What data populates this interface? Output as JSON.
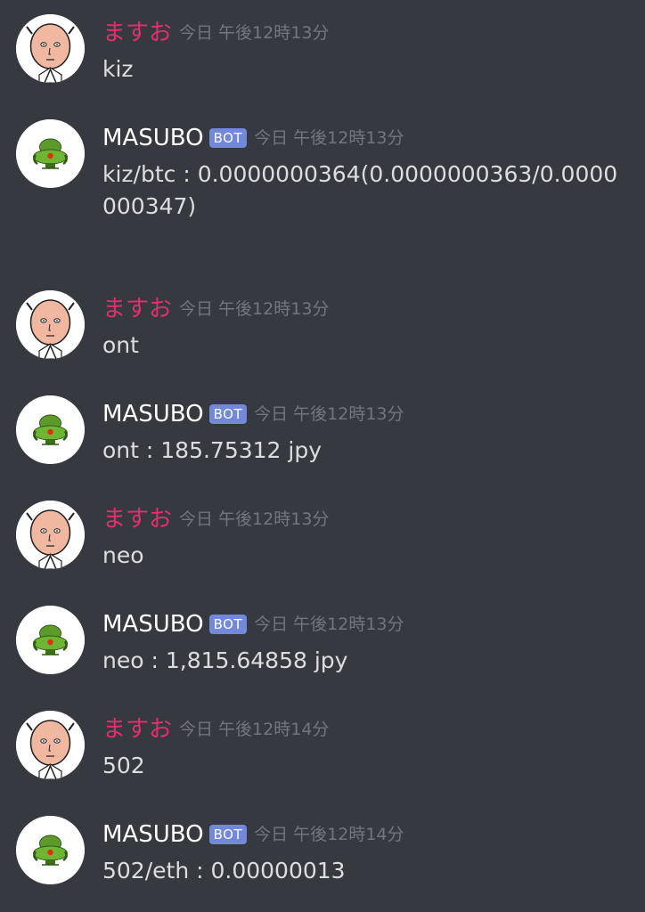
{
  "users": {
    "human": {
      "name": "ますお",
      "color": "#e0306e",
      "avatar": "bald-hero-avatar"
    },
    "bot": {
      "name": "MASUBO",
      "badge": "BOT",
      "color": "#ffffff",
      "avatar": "green-helmet-avatar"
    }
  },
  "messages": [
    {
      "author": "ますお",
      "time": "今日 午後12時13分",
      "text": "kiz"
    },
    {
      "author": "MASUBO",
      "badge": "BOT",
      "time": "今日 午後12時13分",
      "text": "kiz/btc : 0.0000000364(0.0000000363/0.0000000347)"
    },
    {
      "author": "ますお",
      "time": "今日 午後12時13分",
      "text": "ont"
    },
    {
      "author": "MASUBO",
      "badge": "BOT",
      "time": "今日 午後12時13分",
      "text": "ont : 185.75312 jpy"
    },
    {
      "author": "ますお",
      "time": "今日 午後12時13分",
      "text": "neo"
    },
    {
      "author": "MASUBO",
      "badge": "BOT",
      "time": "今日 午後12時13分",
      "text": "neo : 1,815.64858 jpy"
    },
    {
      "author": "ますお",
      "time": "今日 午後12時14分",
      "text": "502"
    },
    {
      "author": "MASUBO",
      "badge": "BOT",
      "time": "今日 午後12時14分",
      "text": "502/eth : 0.00000013"
    }
  ],
  "colors": {
    "background": "#36393f",
    "timestamp": "#72767d",
    "message_text": "#dcddde",
    "bot_badge": "#7289da"
  }
}
